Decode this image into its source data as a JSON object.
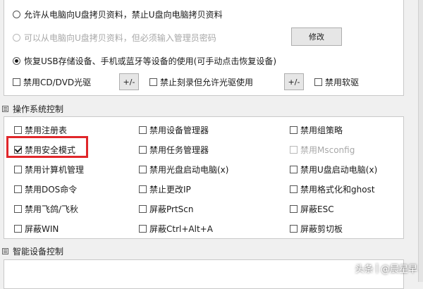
{
  "usb_section": {
    "opt1_label": "允许从电脑向U盘拷贝资料，禁止U盘向电脑拷贝资料",
    "opt2_label": "可以从电脑向U盘拷贝资料，但必须输入管理员密码",
    "modify_label": "修改",
    "opt3_label": "恢复USB存储设备、手机或蓝牙等设备的使用(可手动点击恢复设备)",
    "cd_label": "禁用CD/DVD光驱",
    "plus_minus_1": "+/-",
    "burn_label": "禁止刻录但允许光驱使用",
    "plus_minus_2": "+/-",
    "floppy_label": "禁用软驱"
  },
  "os_section": {
    "title": "操作系统控制",
    "items": [
      [
        "禁用注册表",
        "禁用设备管理器",
        "禁用组策略"
      ],
      [
        "禁用安全模式",
        "禁用任务管理器",
        "禁用Msconfig"
      ],
      [
        "禁用计算机管理",
        "禁用光盘启动电脑(x)",
        "禁用U盘启动电脑(x)"
      ],
      [
        "禁用DOS命令",
        "禁止更改IP",
        "禁用格式化和ghost"
      ],
      [
        "禁用飞鸽/飞秋",
        "屏蔽PrtScn",
        "屏蔽ESC"
      ],
      [
        "屏蔽WIN",
        "屏蔽Ctrl+Alt+A",
        "屏蔽剪切板"
      ]
    ]
  },
  "smart_section": {
    "title": "智能设备控制"
  },
  "watermark": {
    "brand": "头条",
    "author": "@晨星早"
  },
  "colors": {
    "highlight": "#e0262a"
  }
}
